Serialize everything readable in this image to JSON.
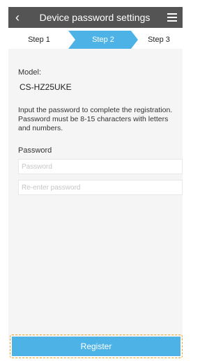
{
  "header": {
    "title": "Device password settings",
    "back_icon": "chevron-left-icon",
    "menu_icon": "hamburger-menu-icon"
  },
  "steps": {
    "items": [
      {
        "label": "Step 1",
        "active": false
      },
      {
        "label": "Step 2",
        "active": true
      },
      {
        "label": "Step 3",
        "active": false
      }
    ],
    "active_color": "#4db3e6",
    "inactive_color": "#ffffff"
  },
  "form": {
    "model_label": "Model:",
    "model_value": "CS-HZ25UKE",
    "instructions": "Input the password to complete the registration. Password must be 8-15 characters with letters and numbers.",
    "password_label": "Password",
    "password_placeholder": "Password",
    "reenter_placeholder": "Re-enter password"
  },
  "actions": {
    "register_label": "Register",
    "highlight_color": "#f0a020",
    "button_color": "#4db3e6"
  }
}
